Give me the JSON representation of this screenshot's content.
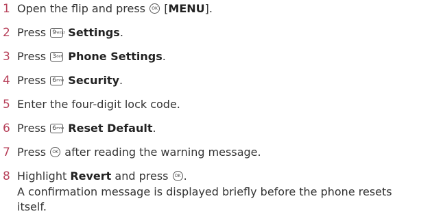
{
  "steps": [
    {
      "num": "1",
      "pre": "Open the flip and press ",
      "ok": "OK",
      "mid": " [",
      "bold": "MENU",
      "post": "]."
    },
    {
      "num": "2",
      "pre": "Press ",
      "keyDigit": "9",
      "keySub": "wxyz",
      "bold": "Settings",
      "post": "."
    },
    {
      "num": "3",
      "pre": "Press ",
      "keyDigit": "3",
      "keySub": "def",
      "bold": "Phone Settings",
      "post": "."
    },
    {
      "num": "4",
      "pre": "Press ",
      "keyDigit": "6",
      "keySub": "mno",
      "bold": "Security",
      "post": "."
    },
    {
      "num": "5",
      "text": "Enter the four-digit lock code."
    },
    {
      "num": "6",
      "pre": "Press ",
      "keyDigit": "6",
      "keySub": "mno",
      "bold": "Reset Default",
      "post": "."
    },
    {
      "num": "7",
      "pre": "Press ",
      "ok": "OK",
      "post": " after reading the warning message."
    },
    {
      "num": "8",
      "pre": "Highlight ",
      "bold": "Revert",
      "mid": " and press ",
      "ok": "OK",
      "post": "."
    }
  ],
  "note": {
    "line1": "A confirmation message is displayed briefly before the phone resets",
    "line2": "itself."
  }
}
